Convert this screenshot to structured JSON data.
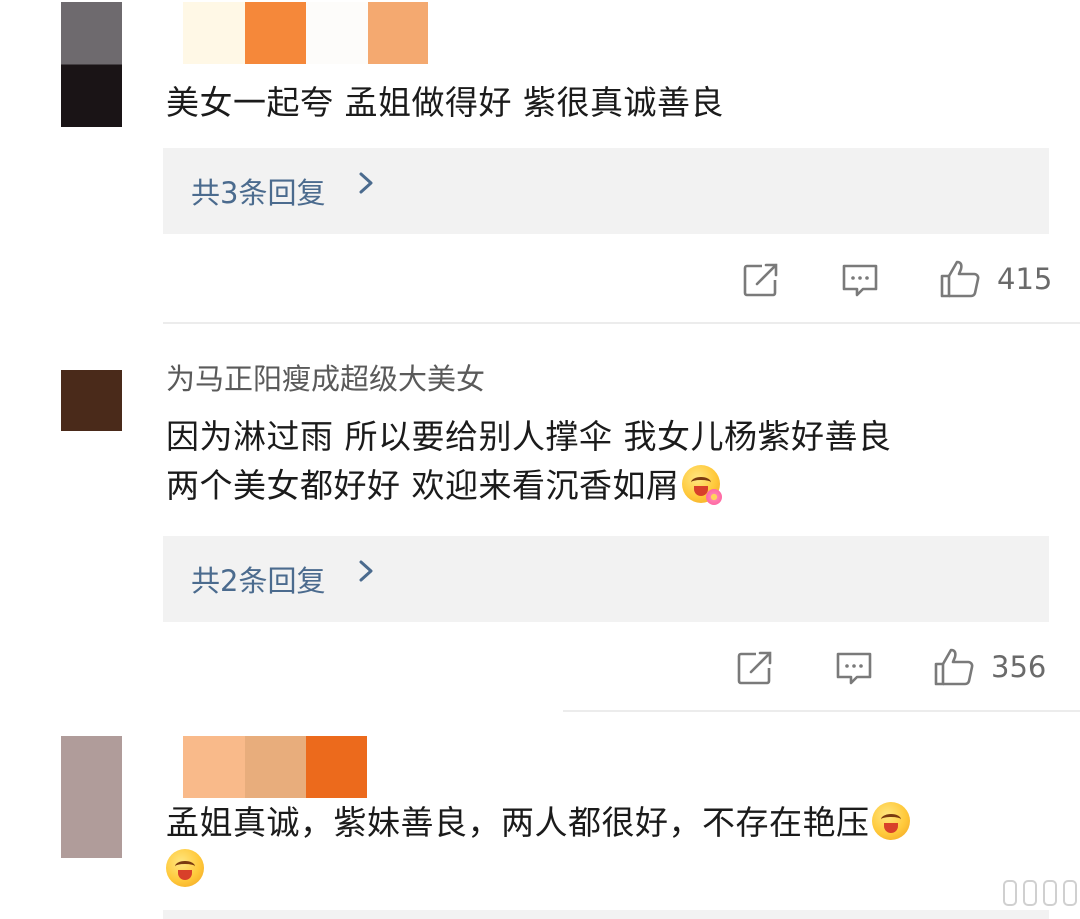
{
  "comments": [
    {
      "username": "",
      "text_lines": [
        "美女一起夸 孟姐做得好 紫很真诚善良"
      ],
      "replies_label": "共3条回复",
      "likes": "415",
      "colors": {
        "avatar_top": "#6e6a6e",
        "avatar_bottom": "#1a1416",
        "name_mosaic": [
          "#fff8e6",
          "#f5883a",
          "#fdfcfa",
          "#f4a970"
        ]
      }
    },
    {
      "username": "为马正阳瘦成超级大美女",
      "text_lines": [
        "因为淋过雨 所以要给别人撑伞 我女儿杨紫好善良",
        "两个美女都好好 欢迎来看沉香如屑"
      ],
      "replies_label": "共2条回复",
      "likes": "356",
      "colors": {
        "avatar": "#4a2a1a"
      }
    },
    {
      "username": "",
      "text_lines": [
        "孟姐真诚，紫妹善良，两人都很好，不存在艳压",
        ""
      ],
      "colors": {
        "avatar": "#b09c9a",
        "name_mosaic": [
          "#f9ba8a",
          "#e8ad7c",
          "#ec6a1c"
        ]
      }
    }
  ],
  "icons": {
    "share": "share-icon",
    "comment": "comment-icon",
    "like": "like-icon",
    "chevron": "chevron-right-icon",
    "emoji": "laugh-emoji-icon"
  },
  "theme": {
    "reply_bg": "#f2f2f2",
    "reply_text": "#4b6b8e",
    "meta_text": "#6a6a6a"
  }
}
